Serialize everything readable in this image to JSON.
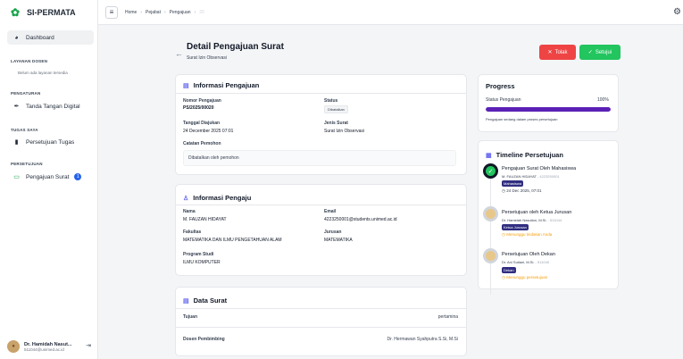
{
  "app": {
    "name": "SI-PERMATA"
  },
  "sidebar": {
    "dashboard": "Dashboard",
    "sections": {
      "layanan": "LAYANAN DOSEN",
      "layanan_empty": "Belum ada layanan tersedia",
      "pengaturan": "PENGATURAN",
      "tugas": "TUGAS SAYA",
      "persetujuan": "PERSETUJUAN"
    },
    "items": {
      "tanda_tangan": "Tanda Tangan Digital",
      "persetujuan_tugas": "Persetujuan Tugas",
      "pengajuan_surat": "Pengajuan Surat",
      "pengajuan_count": "1"
    },
    "user": {
      "name": "Dr. Hamidah Nasut...",
      "email": "511044@unimed.ac.id"
    }
  },
  "breadcrumb": {
    "home": "Home",
    "pejabat": "Pejabat",
    "pengajuan": "Pengajuan",
    "current": "20"
  },
  "header": {
    "title": "Detail Pengajuan Surat",
    "subtitle": "Surat Izin Observasi",
    "reject": "Tolak",
    "approve": "Setujui"
  },
  "info_pengajuan": {
    "title": "Informasi Pengajuan",
    "nomor_label": "Nomor Pengajuan",
    "nomor_value": "PS/2025/00020",
    "status_label": "Status",
    "status_value": "Dibatalkan",
    "tanggal_label": "Tanggal Diajukan",
    "tanggal_value": "24 December 2025 07:01",
    "jenis_label": "Jenis Surat",
    "jenis_value": "Surat Izin Observasi",
    "catatan_label": "Catatan Pemohon",
    "catatan_value": "Dibatalkan oleh pemohon"
  },
  "info_pengaju": {
    "title": "Informasi Pengaju",
    "nama_label": "Nama",
    "nama_value": "M. FAUZAN HIDAYAT",
    "email_label": "Email",
    "email_value": "4223250001@students.unimed.ac.id",
    "fakultas_label": "Fakultas",
    "fakultas_value": "MATEMATIKA DAN ILMU PENGETAHUAN ALAM",
    "jurusan_label": "Jurusan",
    "jurusan_value": "MATEMATIKA",
    "prodi_label": "Program Studi",
    "prodi_value": "ILMU KOMPUTER"
  },
  "data_surat": {
    "title": "Data Surat",
    "tujuan_label": "Tujuan",
    "tujuan_value": "pertamina",
    "dosen_label": "Dosen Pembimbing",
    "dosen_value": "Dr. Hermawan Syahputra S.Si, M.Si"
  },
  "progress": {
    "title": "Progress",
    "label": "Status Pengajuan",
    "percent_text": "100%",
    "percent": 100,
    "note": "Pengajuan sedang dalam proses persetujuan"
  },
  "timeline": {
    "title": "Timeline Persetujuan",
    "steps": [
      {
        "title": "Pengajuan Surat Oleh Mahasiswa",
        "person": "M. FAUZAN HIDAYAT",
        "nip": "- 4223250001",
        "role": "Mahasiswa",
        "meta": "24 Dec 2025, 07:01"
      },
      {
        "title": "Persetujuan oleh Ketua Jurusan",
        "person": "Dr. Hamidah Nasution, M.Si.",
        "nip": "- 511044",
        "role": "Ketua Jurusan",
        "meta": "Menunggu tindakan Anda"
      },
      {
        "title": "Persetujuan Oleh Dekan",
        "person": "Dr. Ani Sutiani, M.Si.",
        "nip": "- 511040",
        "role": "Dekan",
        "meta": "Menunggu persetujuan"
      }
    ]
  },
  "colors": {
    "accent": "#5b21b6",
    "success": "#22c55e",
    "danger": "#ef4444",
    "warning": "#f59e0b",
    "role_badge": "#312e81"
  }
}
